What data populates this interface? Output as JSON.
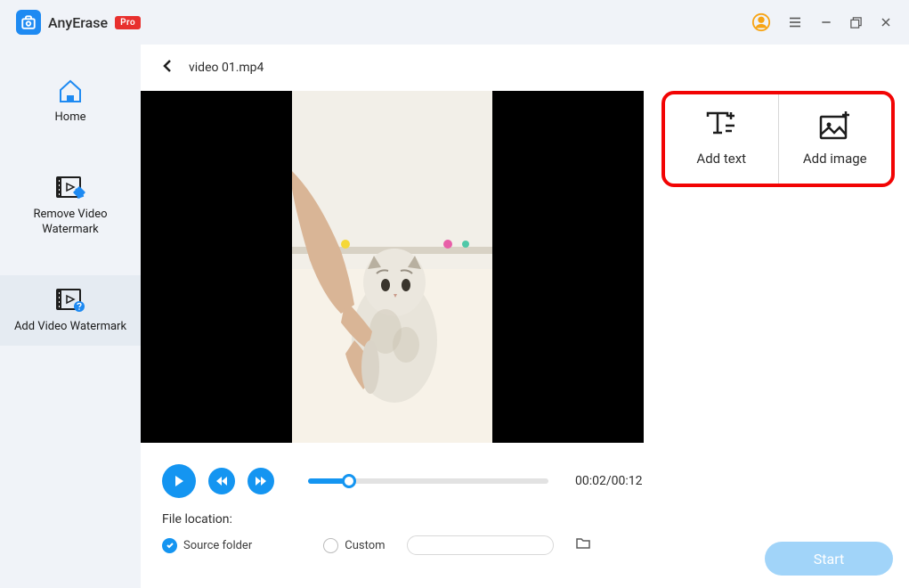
{
  "app": {
    "name": "AnyErase",
    "badge": "Pro"
  },
  "sidebar": {
    "items": [
      {
        "label": "Home"
      },
      {
        "label": "Remove Video Watermark"
      },
      {
        "label": "Add Video Watermark"
      }
    ]
  },
  "header": {
    "filename": "video 01.mp4"
  },
  "side_panel": {
    "add_text": "Add text",
    "add_image": "Add image"
  },
  "playback": {
    "timecode": "00:02/00:12",
    "progress_percent": 17
  },
  "file_location": {
    "label": "File location:",
    "source_folder": "Source folder",
    "custom": "Custom"
  },
  "start_button": "Start"
}
